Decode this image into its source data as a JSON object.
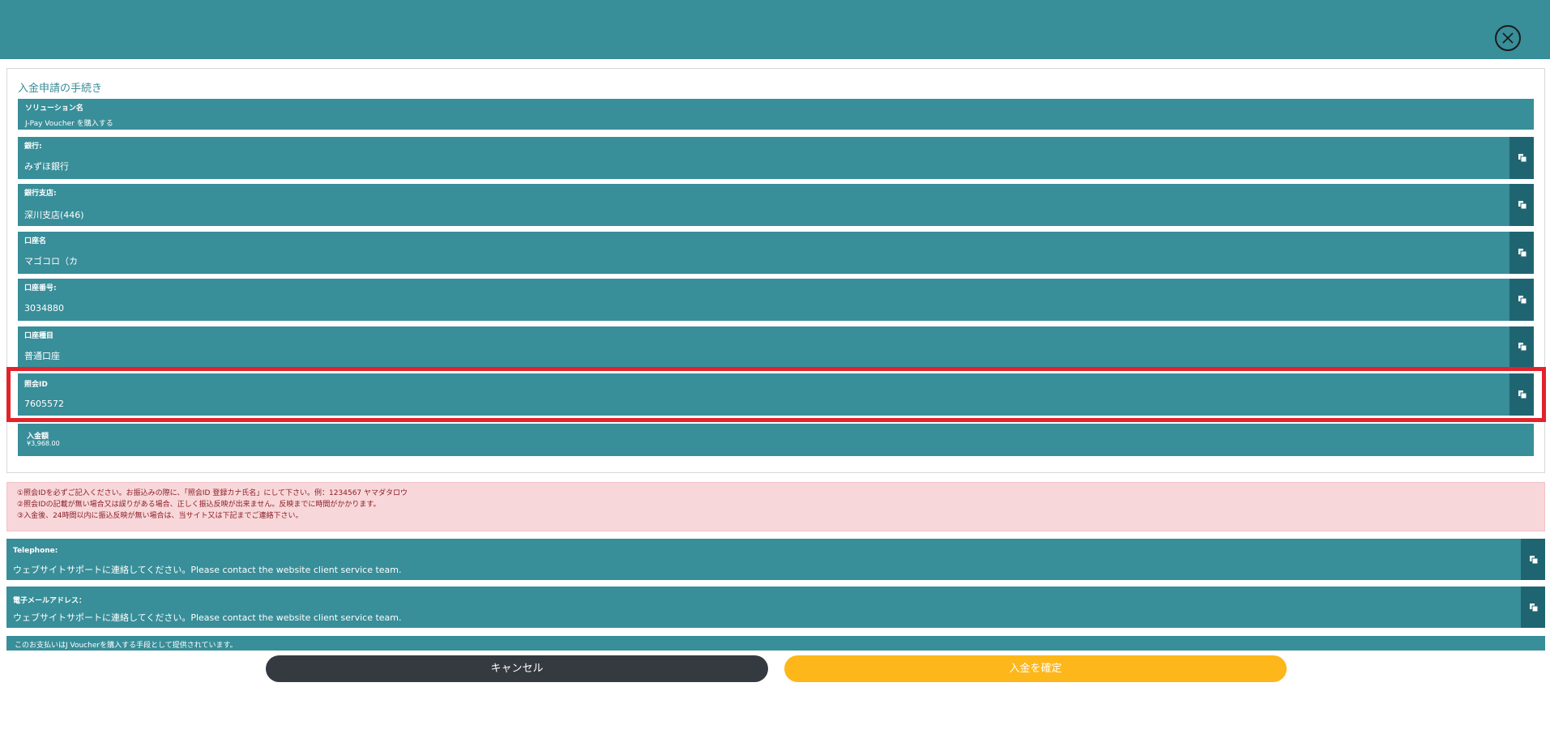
{
  "panel": {
    "title": "入金申請の手続き"
  },
  "fields": [
    {
      "label": "ソリューション名",
      "value": "J-Pay Voucher を購入する"
    },
    {
      "label": "銀行:",
      "value": "みずほ銀行"
    },
    {
      "label": "銀行支店:",
      "value": "深川支店(446)"
    },
    {
      "label": "口座名",
      "value": "マゴコロ（カ"
    },
    {
      "label": "口座番号:",
      "value": "3034880"
    },
    {
      "label": "口座種目",
      "value": "普通口座"
    },
    {
      "label": "照会ID",
      "value": "7605572"
    },
    {
      "label": "入金額",
      "value": "¥3,968.00"
    }
  ],
  "alert": {
    "lines": [
      "①照会IDを必ずご記入ください。お振込みの際に、「照会ID 登録カナ氏名」にして下さい。例：1234567 ヤマダタロウ",
      "②照会IDの記載が無い場合又は誤りがある場合、正しく振込反映が出来ません。反映までに時間がかかります。",
      "③入金後、24時間以内に振込反映が無い場合は、当サイト又は下記までご連絡下さい。"
    ]
  },
  "contacts": [
    {
      "label": "Telephone:",
      "value": "ウェブサイトサポートに連絡してください。Please contact the website client service team."
    },
    {
      "label": "電子メールアドレス：",
      "value": "ウェブサイトサポートに連絡してください。Please contact the website client service team."
    }
  ],
  "note": "このお支払いはJ Voucherを購入する手段として提供されています。",
  "buttons": {
    "cancel": "キャンセル",
    "confirm": "入金を確定"
  },
  "colors": {
    "teal": "#388e99",
    "teal_dark": "#1f6571",
    "highlight": "#e3232c",
    "confirm": "#fdb71a",
    "cancel": "#343a40"
  }
}
